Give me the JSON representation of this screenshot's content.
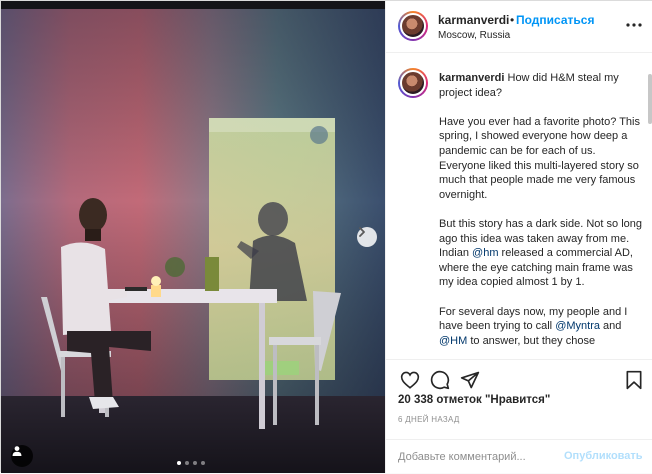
{
  "post": {
    "username": "karmanverdi",
    "follow_label": "Подписаться",
    "separator": "•",
    "location": "Moscow, Russia",
    "more_icon": "ellipsis-icon"
  },
  "caption": {
    "username": "karmanverdi",
    "title": "How did H&M steal my project idea?",
    "p1": "Have you ever had a favorite photo? This spring, I showed everyone how deep a pandemic can be for each of us. Everyone liked this multi-layered story so much that people made me very famous overnight.",
    "p2_a": "But this story has a dark side. Not so long ago this idea was taken away from me. Indian ",
    "p2_m1": "@hm",
    "p2_b": " released a commercial AD, where the eye catching main frame was my idea copied almost 1 by 1.",
    "p3_a": "For several days now, my people and I have been trying to call ",
    "p3_m1": "@Myntra",
    "p3_b": " and ",
    "p3_m2": "@HM",
    "p3_c": " to answer, but they chose"
  },
  "actions": {
    "like_icon": "heart-icon",
    "comment_icon": "comment-icon",
    "share_icon": "share-icon",
    "save_icon": "bookmark-icon",
    "likes_count": "20 338",
    "likes_word": "отметок \"Нравится\"",
    "timestamp": "6 ДНЕЙ НАЗАД"
  },
  "comment_box": {
    "placeholder": "Добавьте комментарий...",
    "post_label": "Опубликовать"
  },
  "carousel": {
    "total": 4,
    "current": 1
  },
  "colors": {
    "link": "#0095f6",
    "mention": "#00376b",
    "post_disabled": "#b2dffc"
  }
}
